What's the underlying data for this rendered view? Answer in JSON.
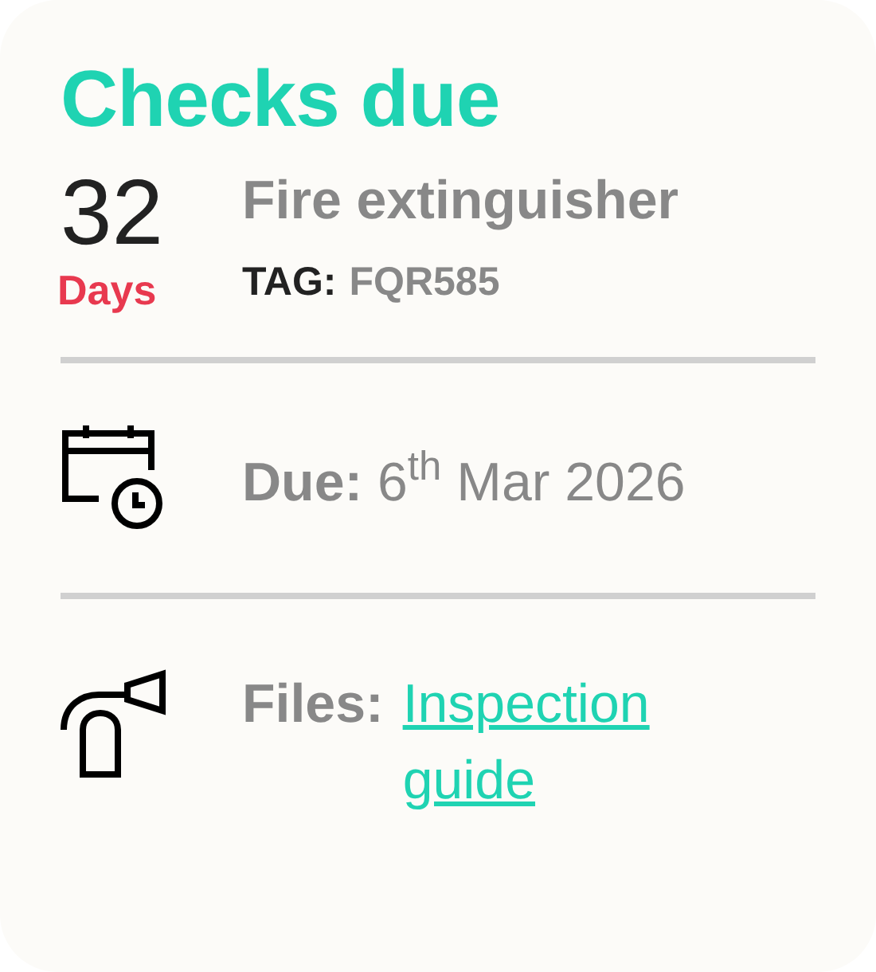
{
  "title": "Checks due",
  "countdown": {
    "value": "32",
    "unit": "Days"
  },
  "item": {
    "name": "Fire extinguisher",
    "tag_label": "TAG:",
    "tag_value": "FQR585"
  },
  "due": "**Due:** 6$^{th}$ Mar 2026",
  "files": {
    "label": "Files:",
    "link": "Inspection guide"
  }
}
